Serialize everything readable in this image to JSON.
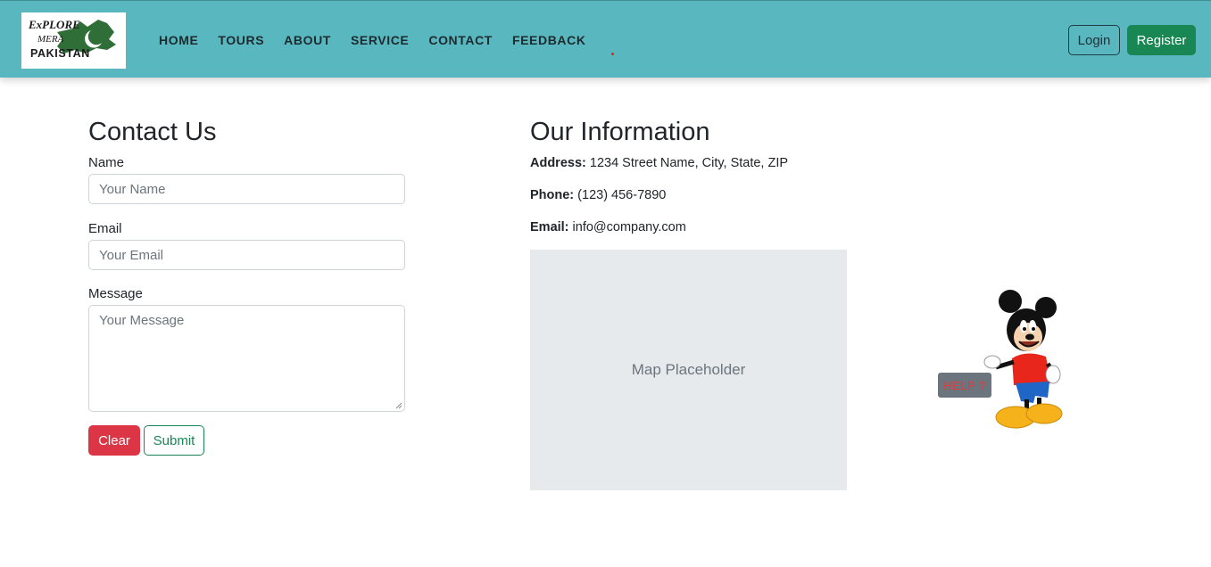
{
  "logo": {
    "line1": "ExPLORE",
    "line2": "MERA",
    "line3": "PAKISTAN"
  },
  "nav": {
    "items": [
      "HOME",
      "TOURS",
      "ABOUT",
      "SERVICE",
      "CONTACT",
      "FEEDBACK"
    ],
    "login_label": "Login",
    "register_label": "Register"
  },
  "contact": {
    "title": "Contact Us",
    "name_label": "Name",
    "name_placeholder": "Your Name",
    "email_label": "Email",
    "email_placeholder": "Your Email",
    "message_label": "Message",
    "message_placeholder": "Your Message",
    "clear_label": "Clear",
    "submit_label": "Submit"
  },
  "info": {
    "title": "Our Information",
    "address_label": "Address:",
    "address_value": "1234 Street Name, City, State, ZIP",
    "phone_label": "Phone:",
    "phone_value": "(123) 456-7890",
    "email_label": "Email:",
    "email_value": "info@company.com",
    "map_text": "Map Placeholder"
  },
  "help": {
    "label": "HELP ?"
  },
  "colors": {
    "navbar": "#58b7bf",
    "success": "#198754",
    "danger": "#dc3545",
    "map_bg": "#e6eaed"
  }
}
